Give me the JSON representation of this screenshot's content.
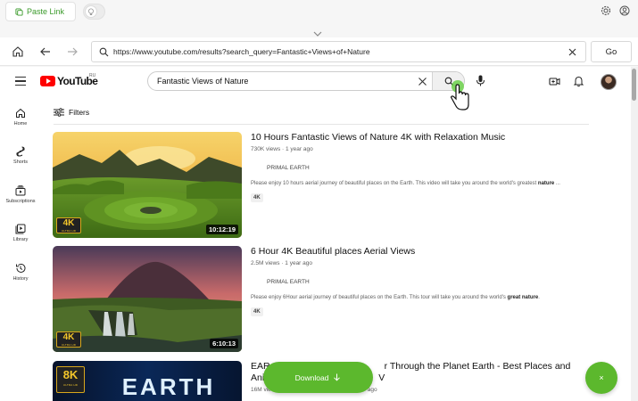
{
  "toolbar": {
    "paste_link_label": "Paste Link"
  },
  "browser": {
    "url": "https://www.youtube.com/results?search_query=Fantastic+Views+of+Nature",
    "go_label": "Go"
  },
  "youtube": {
    "logo_text": "YouTube",
    "country_code": "RU",
    "search_query": "Fantastic Views of Nature",
    "filters_label": "Filters",
    "sidebar": [
      {
        "label": "Home",
        "icon": "home-icon"
      },
      {
        "label": "Shorts",
        "icon": "shorts-icon"
      },
      {
        "label": "Subscriptions",
        "icon": "subscriptions-icon"
      },
      {
        "label": "Library",
        "icon": "library-icon"
      },
      {
        "label": "History",
        "icon": "history-icon"
      }
    ],
    "videos": [
      {
        "title": "10 Hours Fantastic Views of Nature 4K with Relaxation Music",
        "views": "730K views · 1 year ago",
        "channel": "PRIMAL EARTH",
        "description": "Please enjoy 10 hours aerial journey of beautiful places on the Earth. This video will take you around the world's greatest",
        "description_bold": "nature",
        "description_tail": "...",
        "tag": "4K",
        "duration": "10:12:19",
        "badge": "4K",
        "badge_sub": "ULTRA HD"
      },
      {
        "title": "6 Hour 4K Beautiful places Aerial Views",
        "views": "2.5M views · 1 year ago",
        "channel": "PRIMAL EARTH",
        "description": "Please enjoy 6Hour aerial journey of beautiful places on the Earth. This tour will take you around the world's",
        "description_bold": "great nature",
        "description_tail": ".",
        "tag": "4K",
        "duration": "6:10:13",
        "badge": "4K",
        "badge_sub": "ULTRA HD"
      },
      {
        "title_left": "EAR",
        "title_right": "r Through the Planet Earth - Best Places and",
        "title2_left": "Ani",
        "title2_right": "V",
        "views": "16M views",
        "views_right": "ago",
        "thumb_text": "EARTH",
        "badge": "8K",
        "badge_sub": "ULTRA HD"
      }
    ]
  },
  "download": {
    "label": "Download"
  },
  "close_fab": {
    "label": "×"
  },
  "colors": {
    "accent_green": "#5cb82d",
    "youtube_red": "#ff0000"
  }
}
